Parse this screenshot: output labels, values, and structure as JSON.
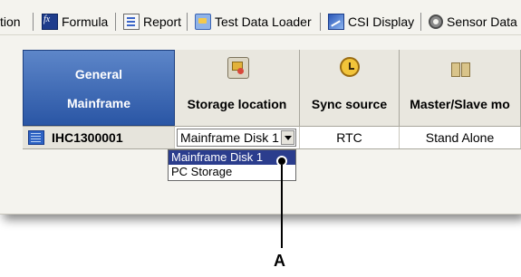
{
  "toolbar": {
    "items": [
      {
        "label": "tion",
        "icon": ""
      },
      {
        "label": "Formula",
        "icon": "formula-icon"
      },
      {
        "label": "Report",
        "icon": "report-icon"
      },
      {
        "label": "Test Data Loader",
        "icon": "test-data-loader-icon"
      },
      {
        "label": "CSI Display",
        "icon": "csi-display-icon"
      },
      {
        "label": "Sensor Data",
        "icon": "sensor-icon"
      }
    ]
  },
  "grid": {
    "general_header": {
      "line1": "General",
      "line2": "Mainframe"
    },
    "columns": [
      {
        "label": "Storage location",
        "icon": "storage-location-icon"
      },
      {
        "label": "Sync source",
        "icon": "clock-icon"
      },
      {
        "label": "Master/Slave mo",
        "icon": "master-slave-icon"
      }
    ],
    "row": {
      "name": "IHC1300001",
      "storage_value": "Mainframe Disk 1",
      "sync_value": "RTC",
      "master_value": "Stand Alone"
    }
  },
  "dropdown": {
    "options": [
      "Mainframe Disk 1",
      "PC Storage"
    ],
    "selected": "Mainframe Disk 1"
  },
  "callout": {
    "label": "A"
  },
  "colors": {
    "header_blue": "#2a56a5",
    "selection": "#2b3d8d"
  }
}
